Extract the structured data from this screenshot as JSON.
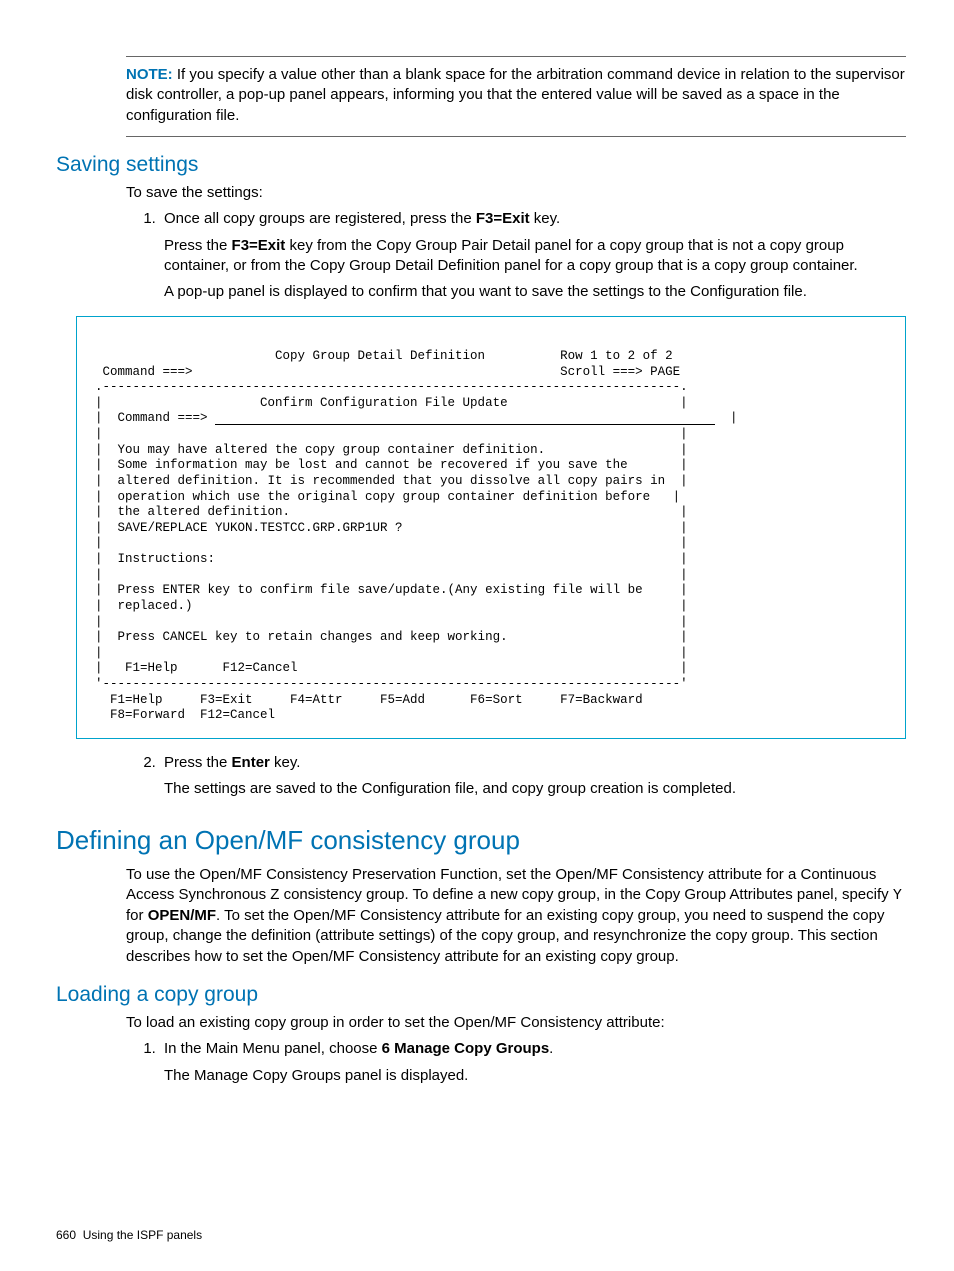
{
  "note": {
    "label": "NOTE:",
    "text": "If you specify a value other than a blank space for the arbitration command device in relation to the supervisor disk controller, a pop-up panel appears, informing you that the entered value will be saved as a space in the configuration file."
  },
  "saving": {
    "heading": "Saving settings",
    "intro": "To save the settings:",
    "step1_pre": "Once all copy groups are registered, press the ",
    "step1_key": "F3=Exit",
    "step1_post": " key.",
    "step1_sub1_pre": "Press the ",
    "step1_sub1_key": "F3=Exit",
    "step1_sub1_post": " key from the Copy Group Pair Detail panel for a copy group that is not a copy group container, or from the Copy Group Detail Definition panel for a copy group that is a copy group container.",
    "step1_sub2": "A pop-up panel is displayed to confirm that you want to save the settings to the Configuration file.",
    "step2_pre": "Press the ",
    "step2_key": "Enter",
    "step2_post": " key.",
    "step2_sub": "The settings are saved to the Configuration file, and copy group creation is completed."
  },
  "terminal": {
    "title_line": "                        Copy Group Detail Definition          Row 1 to 2 of 2",
    "cmd_line": " Command ===>                                                 Scroll ===> PAGE",
    "top_border": ".-----------------------------------------------------------------------------.",
    "popup_title": "|                     Confirm Configuration File Update                       |",
    "popup_cmd": "|  Command ===> ",
    "blank": "|                                                                             |",
    "l1": "|  You may have altered the copy group container definition.                  |",
    "l2": "|  Some information may be lost and cannot be recovered if you save the       |",
    "l3": "|  altered definition. It is recommended that you dissolve all copy pairs in  |",
    "l4": "|  operation which use the original copy group container definition before   |",
    "l5": "|  the altered definition.                                                    |",
    "l6": "|  SAVE/REPLACE YUKON.TESTCC.GRP.GRP1UR ?                                     |",
    "l7": "|  Instructions:                                                              |",
    "l8": "|  Press ENTER key to confirm file save/update.(Any existing file will be     |",
    "l9": "|  replaced.)                                                                 |",
    "l10": "|  Press CANCEL key to retain changes and keep working.                       |",
    "l11": "|   F1=Help      F12=Cancel                                                   |",
    "bot_border": "'-----------------------------------------------------------------------------'",
    "fkeys1": "  F1=Help     F3=Exit     F4=Attr     F5=Add      F6=Sort     F7=Backward",
    "fkeys2": "  F8=Forward  F12=Cancel"
  },
  "defining": {
    "heading": "Defining an Open/MF consistency group",
    "p1_pre": "To use the Open/MF Consistency Preservation Function, set the Open/MF Consistency attribute for a Continuous Access Synchronous Z consistency group. To define a new copy group, in the Copy Group Attributes panel, specify ",
    "y": "Y",
    "p1_mid": " for ",
    "openmf": "OPEN/MF",
    "p1_post": ". To set the Open/MF Consistency attribute for an existing copy group, you need to suspend the copy group, change the definition (attribute settings) of the copy group, and resynchronize the copy group. This section describes how to set the Open/MF Consistency attribute for an existing copy group."
  },
  "loading": {
    "heading": "Loading a copy group",
    "intro": "To load an existing copy group in order to set the Open/MF Consistency attribute:",
    "step1_pre": "In the Main Menu panel, choose ",
    "step1_bold": "6 Manage Copy Groups",
    "step1_post": ".",
    "step1_sub": "The Manage Copy Groups panel is displayed."
  },
  "footer": {
    "page": "660",
    "title": "Using the ISPF panels"
  }
}
